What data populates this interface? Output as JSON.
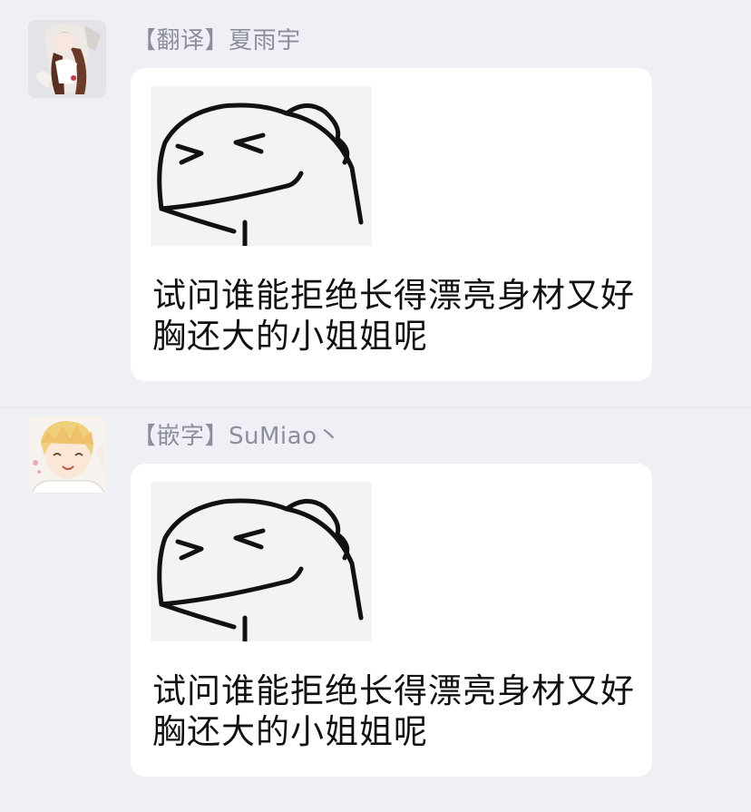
{
  "messages": [
    {
      "sender": "【翻译】夏雨宇",
      "text": "试问谁能拒绝长得漂亮身材又好胸还大的小姐姐呢",
      "avatar_icon": "anime-girl-avatar-icon",
      "sticker_icon": "squinting-dinosaur-sticker-icon"
    },
    {
      "sender": "【嵌字】SuMiao丶",
      "text": "试问谁能拒绝长得漂亮身材又好胸还大的小姐姐呢",
      "avatar_icon": "anime-boy-avatar-icon",
      "sticker_icon": "squinting-dinosaur-sticker-icon"
    }
  ],
  "colors": {
    "background": "#eff0f5",
    "bubble": "#ffffff",
    "sender_text": "#8c8f9b",
    "message_text": "#111111"
  }
}
